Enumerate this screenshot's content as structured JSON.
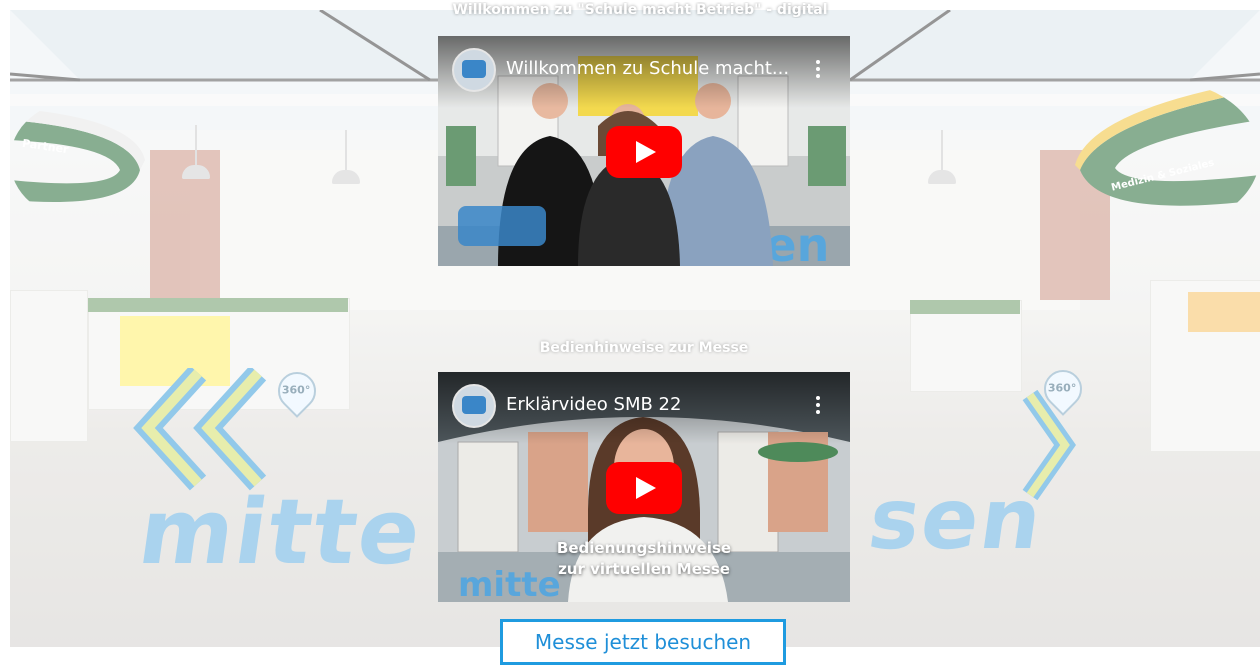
{
  "page": {
    "welcome_text": "Willkommen zu \"Schule macht Betrieb\" - digital",
    "section_heading": "Bedienhinweise zur Messe",
    "visit_button": "Messe jetzt besuchen"
  },
  "scene": {
    "ring_left_label": "Partner",
    "ring_right_label": "Medizin & Soziales",
    "floor_word": "mitte...sen",
    "pin_label": "360°",
    "colors": {
      "accent_blue": "#1f9be0",
      "ring_green": "#3f7d4e",
      "ring_yellow": "#f2c94c",
      "youtube_red": "#ff0000"
    }
  },
  "videos": [
    {
      "title": "Willkommen zu Schule macht...",
      "caption": "",
      "icons": [
        "channel-avatar",
        "more-vert-icon",
        "play-icon"
      ]
    },
    {
      "title": "Erklärvideo SMB 22",
      "caption_line1": "Bedienungshinweise",
      "caption_line2": "zur virtuellen Messe",
      "icons": [
        "channel-avatar",
        "more-vert-icon",
        "play-icon"
      ]
    }
  ]
}
